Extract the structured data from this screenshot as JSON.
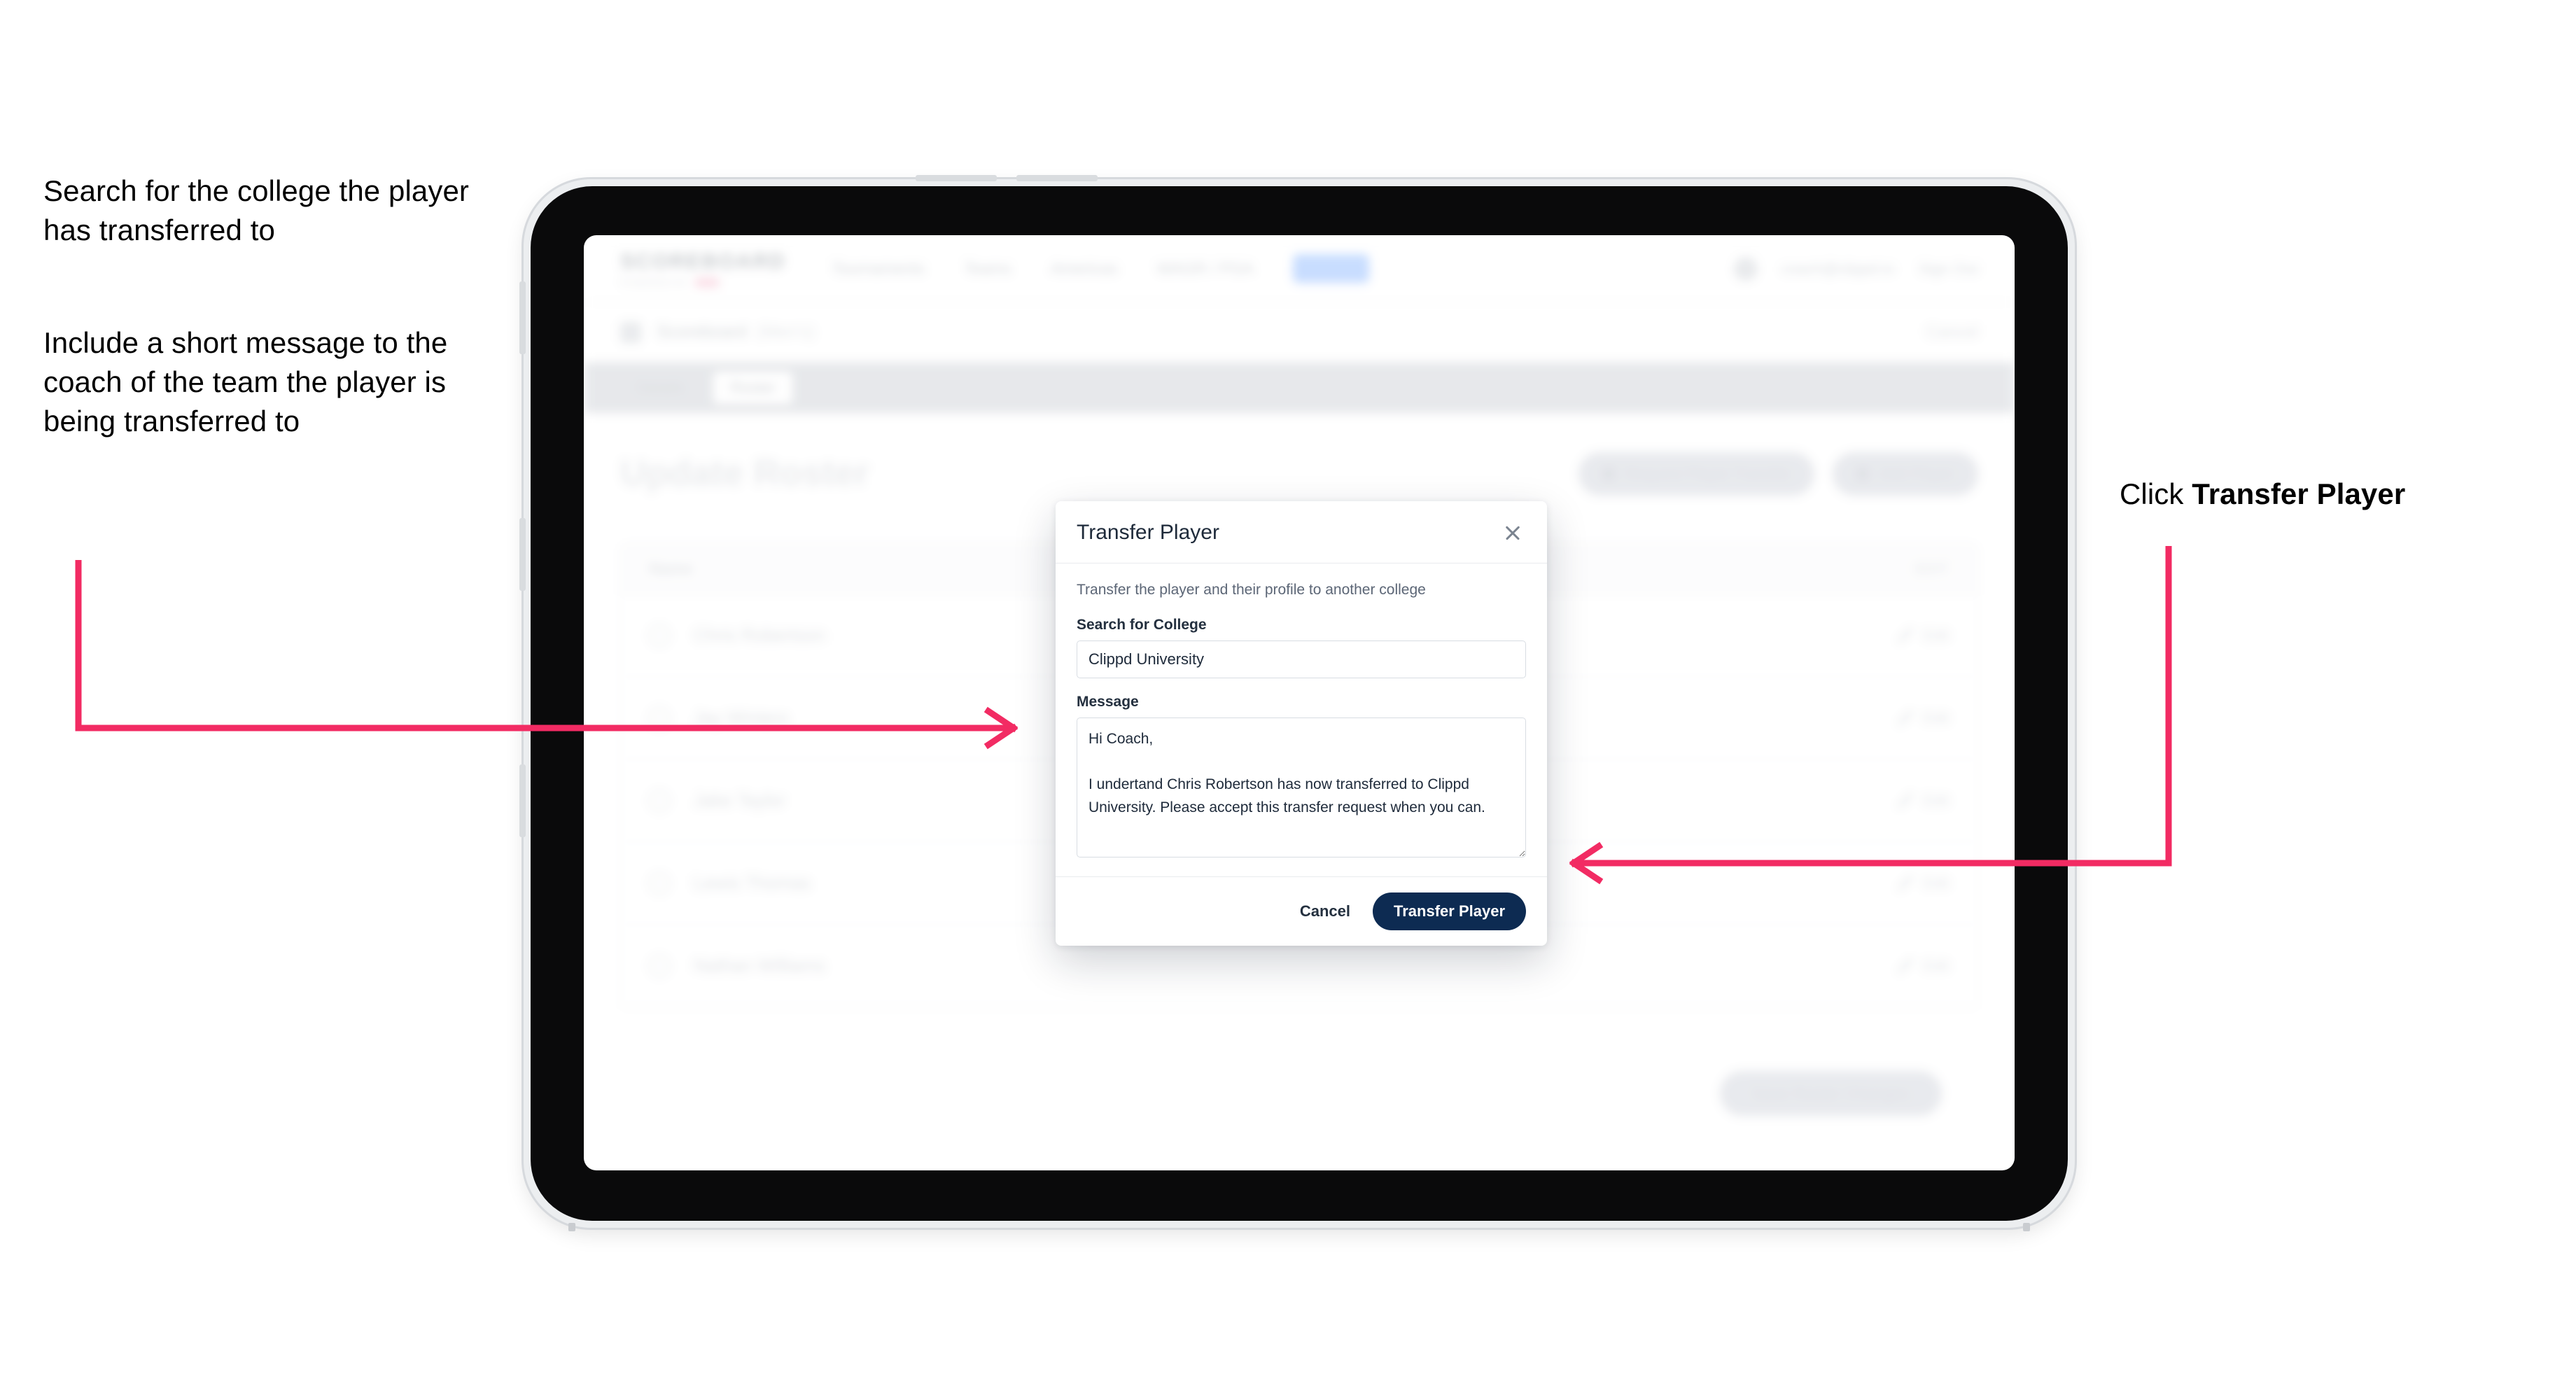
{
  "annotations": {
    "left_top": "Search for the college the player has transferred to",
    "left_bottom": "Include a short message to the coach of the team the player is being transferred to",
    "right_prefix": "Click ",
    "right_bold": "Transfer Player"
  },
  "colors": {
    "arrow_pink": "#F22B63",
    "primary_navy": "#0d2b52",
    "nav_active_blue": "#9cc2ff"
  },
  "app": {
    "brand": {
      "word": "SCOREBOARD",
      "sub": "POWERED BY",
      "badge": "clippd"
    },
    "nav": [
      {
        "label": "Tournaments"
      },
      {
        "label": "Teams"
      },
      {
        "label": "Americas"
      },
      {
        "label": "WAGR / PGA"
      },
      {
        "label": "Admin"
      }
    ],
    "topright": {
      "email": "coach@clippd.io",
      "signout": "Sign Out"
    },
    "breadcrumb": {
      "title": "Scoreboard",
      "sub": "(Men's)",
      "right": "Cancel"
    },
    "tabs": [
      {
        "label": "Details",
        "active": false
      },
      {
        "label": "Roster",
        "active": true
      }
    ],
    "page_title": "Update Roster",
    "page_actions": [
      {
        "label": "Request Player Transfer"
      },
      {
        "label": "Add Player"
      }
    ],
    "roster": {
      "header_left": "Name",
      "header_right": "EDIT",
      "rows": [
        {
          "name": "Chris Robertson",
          "edit": "Edit"
        },
        {
          "name": "Jay Winters",
          "edit": "Edit"
        },
        {
          "name": "Jake Taylor",
          "edit": "Edit"
        },
        {
          "name": "Lewis Thomas",
          "edit": "Edit"
        },
        {
          "name": "Nathan Williams",
          "edit": "Edit"
        }
      ]
    },
    "footer_action": "Save Roster Changes"
  },
  "modal": {
    "title": "Transfer Player",
    "close_icon": "close-icon",
    "description": "Transfer the player and their profile to another college",
    "college_label": "Search for College",
    "college_value": "Clippd University",
    "college_placeholder": "Search for College",
    "message_label": "Message",
    "message_value": "Hi Coach,\n\nI undertand Chris Robertson has now transferred to Clippd University. Please accept this transfer request when you can.",
    "message_placeholder": "Message",
    "cancel_label": "Cancel",
    "submit_label": "Transfer Player"
  }
}
